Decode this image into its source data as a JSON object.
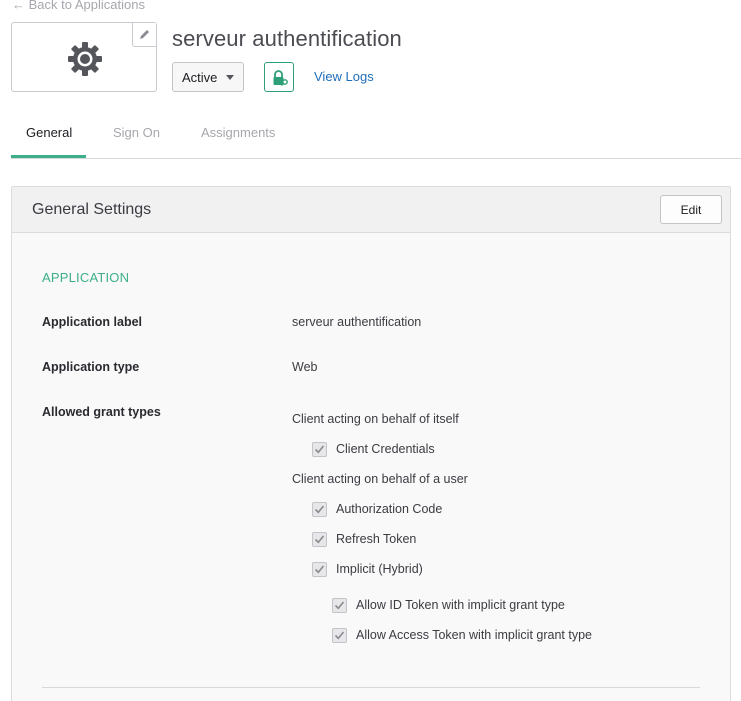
{
  "nav": {
    "back_label": "← Back to Applications"
  },
  "app": {
    "title": "serveur authentification",
    "status": "Active",
    "view_logs": "View Logs"
  },
  "tabs": [
    {
      "label": "General",
      "active": true
    },
    {
      "label": "Sign On",
      "active": false
    },
    {
      "label": "Assignments",
      "active": false
    }
  ],
  "panel": {
    "title": "General Settings",
    "edit_label": "Edit",
    "section": "APPLICATION",
    "fields": {
      "label": {
        "name": "Application label",
        "value": "serveur authentification"
      },
      "type": {
        "name": "Application type",
        "value": "Web"
      },
      "grants": {
        "name": "Allowed grant types"
      }
    },
    "grant_groups": {
      "self": {
        "title": "Client acting on behalf of itself",
        "items": [
          "Client Credentials"
        ]
      },
      "user": {
        "title": "Client acting on behalf of a user",
        "items": [
          "Authorization Code",
          "Refresh Token",
          "Implicit (Hybrid)"
        ],
        "implicit_sub": [
          "Allow ID Token with implicit grant type",
          "Allow Access Token with implicit grant type"
        ]
      }
    }
  },
  "colors": {
    "accent": "#3cae8a",
    "link": "#1f6fb8",
    "push_border": "#2e9f77"
  },
  "icons": {
    "app_logo": "gear-icon",
    "logo_edit": "pencil-icon",
    "push": "lock-key-icon",
    "status_caret": "caret-down-icon",
    "check": "check-icon"
  }
}
